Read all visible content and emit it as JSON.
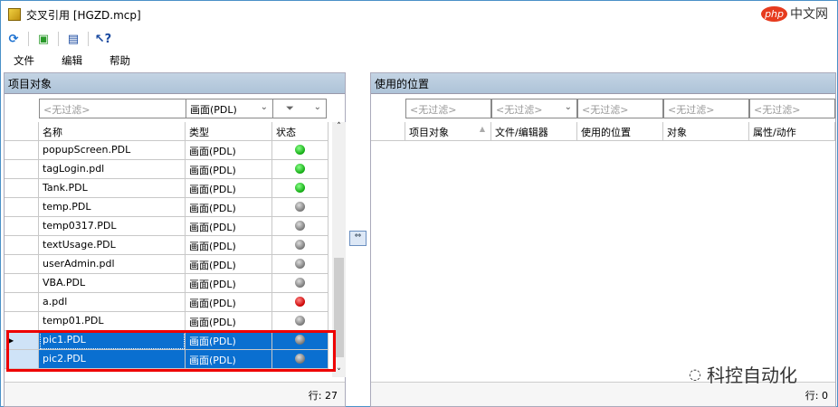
{
  "window": {
    "title": "交叉引用 [HGZD.mcp]"
  },
  "watermarks": {
    "top": "中文网",
    "top_badge": "php",
    "bottom": "科控自动化"
  },
  "toolbar": [
    "refresh-icon",
    "export-icon",
    "print-icon",
    "help-icon"
  ],
  "menu": [
    "文件",
    "编辑",
    "帮助"
  ],
  "left": {
    "title": "项目对象",
    "filters": {
      "name": "<无过滤>",
      "type": "画面(PDL)",
      "status": ""
    },
    "columns": [
      "名称",
      "类型",
      "状态"
    ],
    "rows": [
      {
        "name": "popupScreen.PDL",
        "type": "画面(PDL)",
        "status": "green"
      },
      {
        "name": "tagLogin.pdl",
        "type": "画面(PDL)",
        "status": "green"
      },
      {
        "name": "Tank.PDL",
        "type": "画面(PDL)",
        "status": "green"
      },
      {
        "name": "temp.PDL",
        "type": "画面(PDL)",
        "status": "gray"
      },
      {
        "name": "temp0317.PDL",
        "type": "画面(PDL)",
        "status": "gray"
      },
      {
        "name": "textUsage.PDL",
        "type": "画面(PDL)",
        "status": "gray"
      },
      {
        "name": "userAdmin.pdl",
        "type": "画面(PDL)",
        "status": "gray"
      },
      {
        "name": "VBA.PDL",
        "type": "画面(PDL)",
        "status": "gray"
      },
      {
        "name": "a.pdl",
        "type": "画面(PDL)",
        "status": "red"
      },
      {
        "name": "temp01.PDL",
        "type": "画面(PDL)",
        "status": "gray"
      },
      {
        "name": "pic1.PDL",
        "type": "画面(PDL)",
        "status": "gray",
        "selected": true
      },
      {
        "name": "pic2.PDL",
        "type": "画面(PDL)",
        "status": "gray",
        "selected": true
      }
    ],
    "row_count": "行: 27"
  },
  "right": {
    "title": "使用的位置",
    "filters": [
      "<无过滤>",
      "<无过滤>",
      "<无过滤>",
      "<无过滤>",
      "<无过滤>"
    ],
    "columns": [
      "项目对象",
      "文件/编辑器",
      "使用的位置",
      "对象",
      "属性/动作"
    ],
    "row_count": "行: 0"
  }
}
